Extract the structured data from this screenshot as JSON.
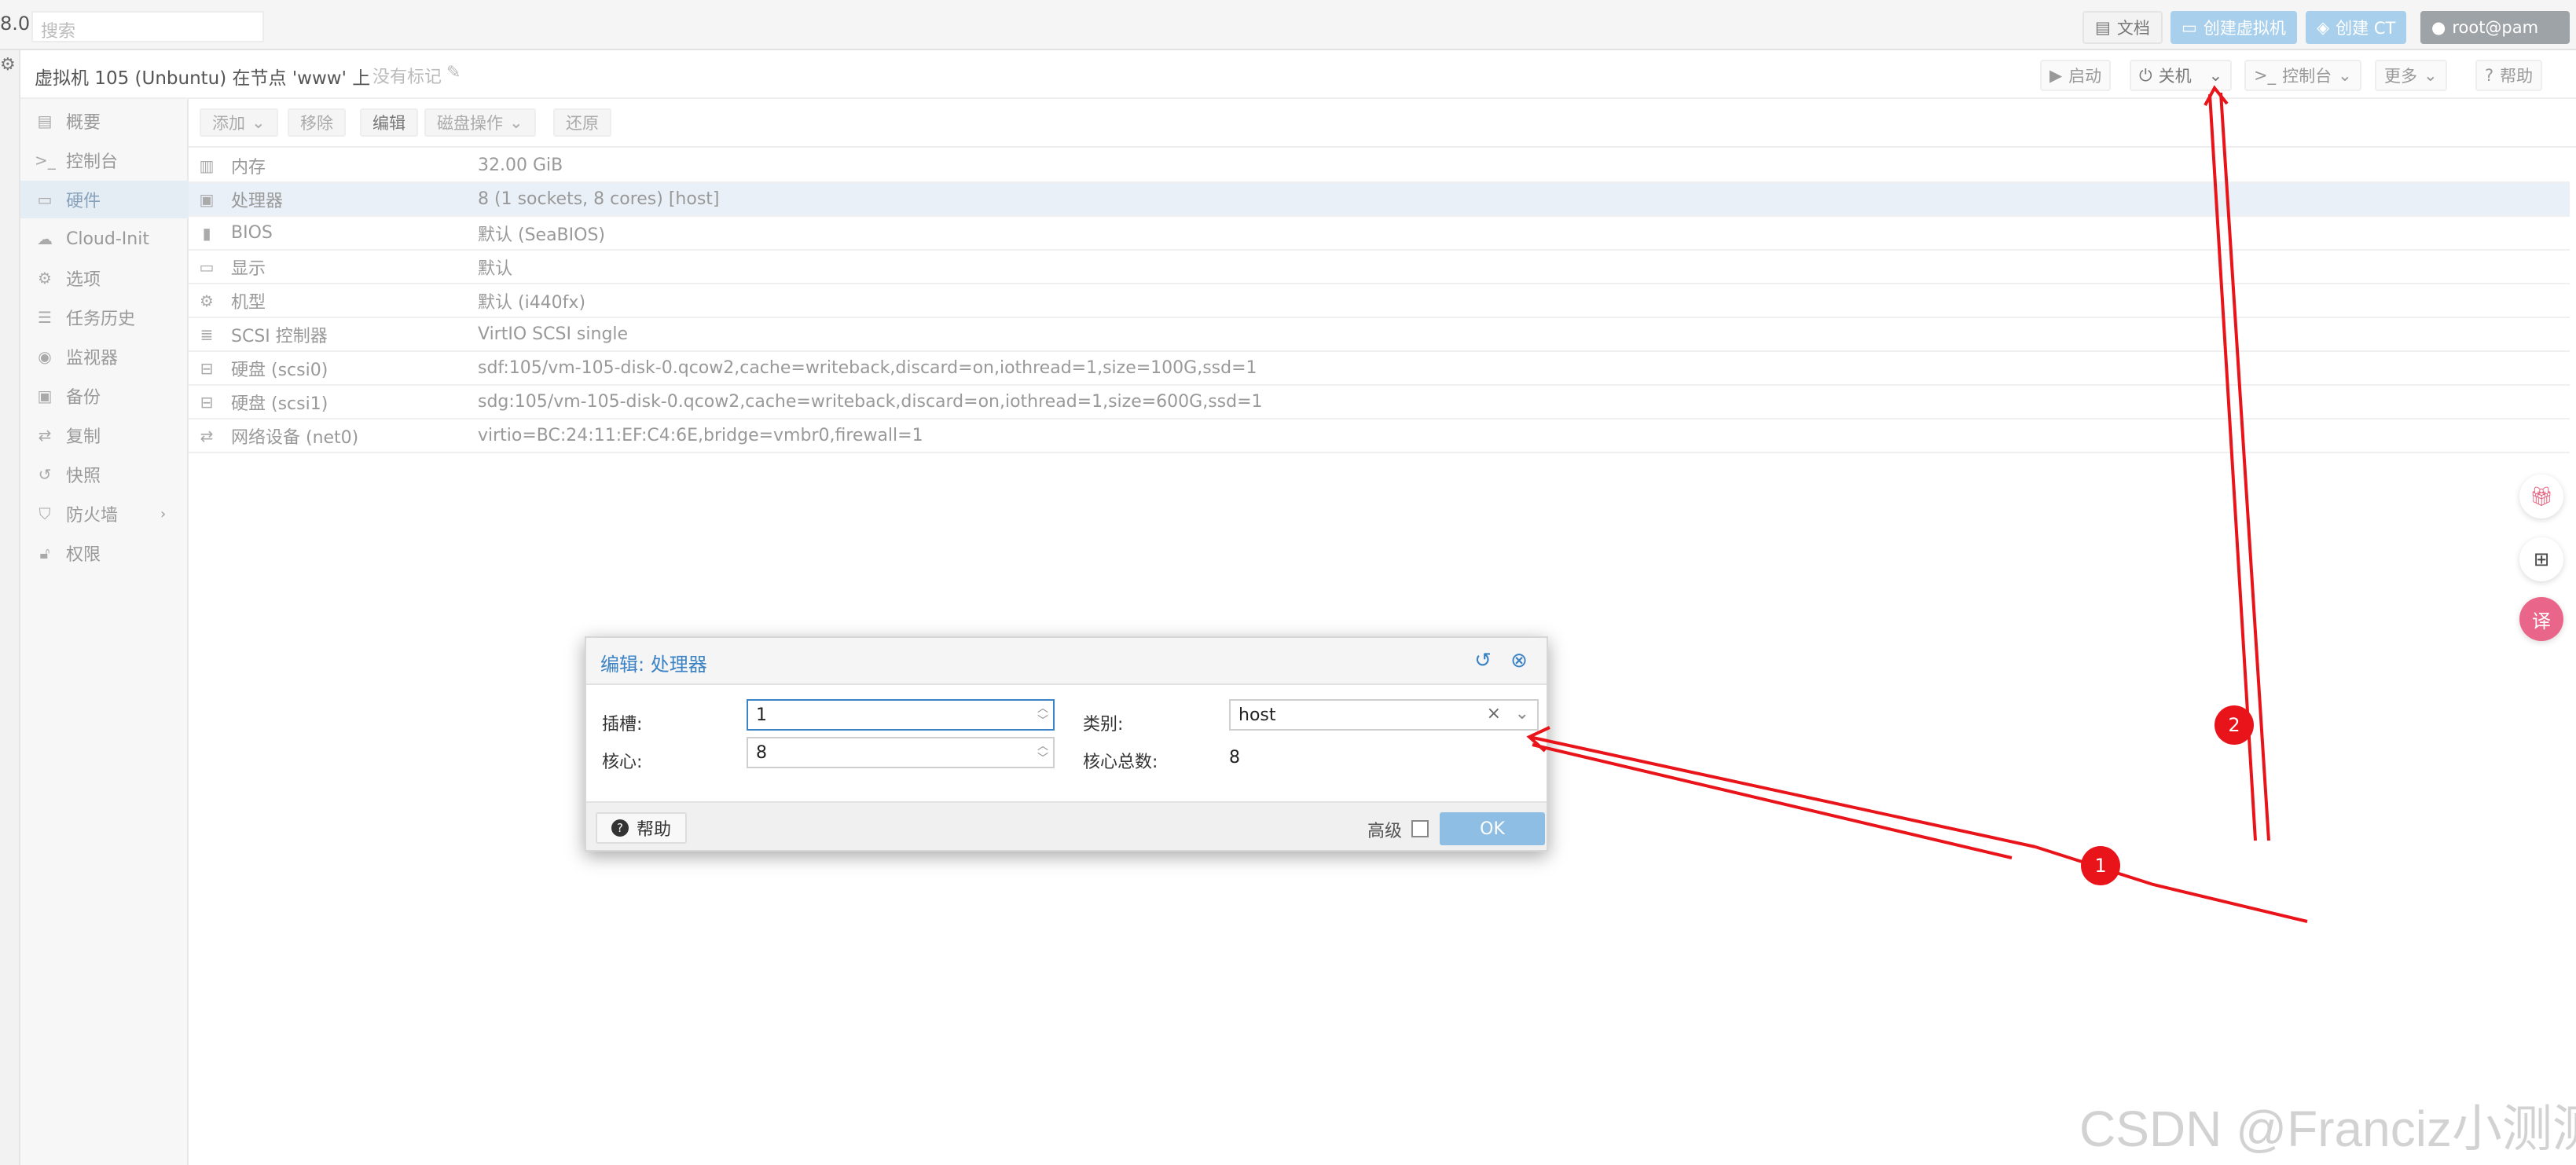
{
  "topbar": {
    "version": "8.0",
    "search_placeholder": "搜索",
    "docs_label": "文档",
    "create_vm_label": "创建虚拟机",
    "create_ct_label": "创建 CT",
    "user_label": "root@pam"
  },
  "titlebar": {
    "title": "虚拟机 105 (Unbuntu) 在节点 'www' 上",
    "no_tags": "没有标记",
    "start_label": "启动",
    "shutdown_label": "关机",
    "console_label": "控制台",
    "more_label": "更多",
    "help_label": "帮助"
  },
  "sidebar": {
    "items": [
      {
        "label": "概要",
        "icon": "book-icon"
      },
      {
        "label": "控制台",
        "icon": "terminal-icon"
      },
      {
        "label": "硬件",
        "icon": "monitor-icon"
      },
      {
        "label": "Cloud-Init",
        "icon": "cloud-icon"
      },
      {
        "label": "选项",
        "icon": "gear-icon"
      },
      {
        "label": "任务历史",
        "icon": "list-icon"
      },
      {
        "label": "监视器",
        "icon": "eye-icon"
      },
      {
        "label": "备份",
        "icon": "floppy-icon"
      },
      {
        "label": "复制",
        "icon": "retweet-icon"
      },
      {
        "label": "快照",
        "icon": "history-icon"
      },
      {
        "label": "防火墙",
        "icon": "shield-icon"
      },
      {
        "label": "权限",
        "icon": "unlock-icon"
      }
    ]
  },
  "toolbar": {
    "add_label": "添加",
    "remove_label": "移除",
    "edit_label": "编辑",
    "disk_action_label": "磁盘操作",
    "revert_label": "还原"
  },
  "hardware": {
    "rows": [
      {
        "name": "内存",
        "value": "32.00 GiB",
        "icon": "memory-icon"
      },
      {
        "name": "处理器",
        "value": "8 (1 sockets, 8 cores) [host]",
        "icon": "cpu-icon"
      },
      {
        "name": "BIOS",
        "value": "默认 (SeaBIOS)",
        "icon": "microchip-icon"
      },
      {
        "name": "显示",
        "value": "默认",
        "icon": "desktop-icon"
      },
      {
        "name": "机型",
        "value": "默认 (i440fx)",
        "icon": "cogs-icon"
      },
      {
        "name": "SCSI 控制器",
        "value": "VirtIO SCSI single",
        "icon": "database-icon"
      },
      {
        "name": "硬盘 (scsi0)",
        "value": "sdf:105/vm-105-disk-0.qcow2,cache=writeback,discard=on,iothread=1,size=100G,ssd=1",
        "icon": "hdd-icon"
      },
      {
        "name": "硬盘 (scsi1)",
        "value": "sdg:105/vm-105-disk-0.qcow2,cache=writeback,discard=on,iothread=1,size=600G,ssd=1",
        "icon": "hdd-icon"
      },
      {
        "name": "网络设备 (net0)",
        "value": "virtio=BC:24:11:EF:C4:6E,bridge=vmbr0,firewall=1",
        "icon": "exchange-icon"
      }
    ]
  },
  "dialog": {
    "title": "编辑: 处理器",
    "sockets_label": "插槽:",
    "sockets_value": "1",
    "cores_label": "核心:",
    "cores_value": "8",
    "type_label": "类别:",
    "type_value": "host",
    "total_cores_label": "核心总数:",
    "total_cores_value": "8",
    "help_label": "帮助",
    "advanced_label": "高级",
    "ok_label": "OK"
  },
  "annotations": {
    "marker_1": "1",
    "marker_2": "2",
    "color": "#e8141a"
  },
  "watermark": "CSDN @Franciz小测测"
}
